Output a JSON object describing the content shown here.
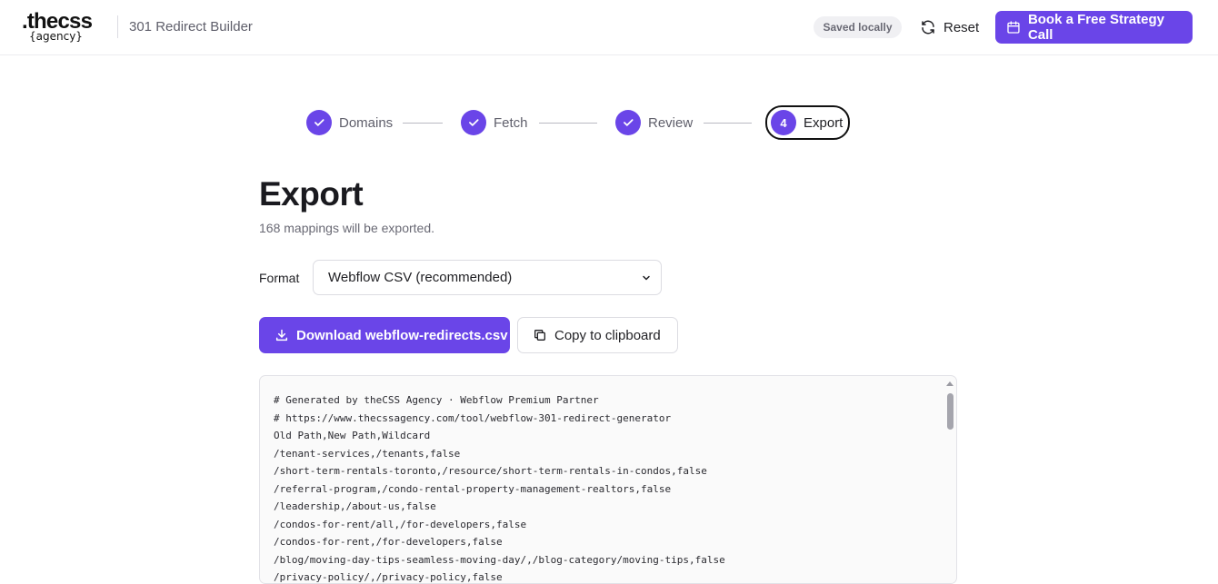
{
  "header": {
    "logo_main": ".thecss",
    "logo_sub": "{agency}",
    "app_title": "301 Redirect Builder",
    "saved_badge": "Saved locally",
    "reset_label": "Reset",
    "cta_label": "Book a Free Strategy Call"
  },
  "stepper": {
    "steps": [
      {
        "label": "Domains",
        "state": "complete"
      },
      {
        "label": "Fetch",
        "state": "complete"
      },
      {
        "label": "Review",
        "state": "complete"
      },
      {
        "label": "Export",
        "state": "active",
        "number": "4"
      }
    ]
  },
  "main": {
    "title": "Export",
    "subtitle": "168 mappings will be exported.",
    "format_label": "Format",
    "format_value": "Webflow CSV (recommended)",
    "download_label": "Download webflow-redirects.csv",
    "copy_label": "Copy to clipboard"
  },
  "output": {
    "lines": [
      "# Generated by theCSS Agency · Webflow Premium Partner",
      "# https://www.thecssagency.com/tool/webflow-301-redirect-generator",
      "Old Path,New Path,Wildcard",
      "/tenant-services,/tenants,false",
      "/short-term-rentals-toronto,/resource/short-term-rentals-in-condos,false",
      "/referral-program,/condo-rental-property-management-realtors,false",
      "/leadership,/about-us,false",
      "/condos-for-rent/all,/for-developers,false",
      "/condos-for-rent,/for-developers,false",
      "/blog/moving-day-tips-seamless-moving-day/,/blog-category/moving-tips,false",
      "/privacy-policy/,/privacy-policy,false"
    ]
  },
  "colors": {
    "accent": "#6a45e8",
    "badge_bg": "#f0f0f3"
  },
  "icons": {
    "reset": "refresh-icon",
    "cta": "calendar-icon",
    "step_complete": "check-icon",
    "download": "download-icon",
    "copy": "copy-icon",
    "select": "chevron-down-icon"
  }
}
